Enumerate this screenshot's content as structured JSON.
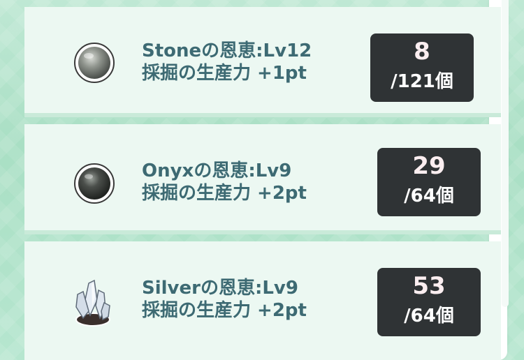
{
  "items": [
    {
      "icon": "stone-orb-icon",
      "title": "Stoneの恩恵:Lv12",
      "description": "採掘の生産力 +1pt",
      "count": "8",
      "total": "/121個"
    },
    {
      "icon": "onyx-orb-icon",
      "title": "Onyxの恩恵:Lv9",
      "description": "採掘の生産力 +2pt",
      "count": "29",
      "total": "/64個"
    },
    {
      "icon": "silver-crystal-icon",
      "title": "Silverの恩恵:Lv9",
      "description": "採掘の生産力 +2pt",
      "count": "53",
      "total": "/64個"
    }
  ],
  "colors": {
    "text": "#3d6a73",
    "card": "#ecf8f2",
    "count_box": "#2f3335"
  }
}
